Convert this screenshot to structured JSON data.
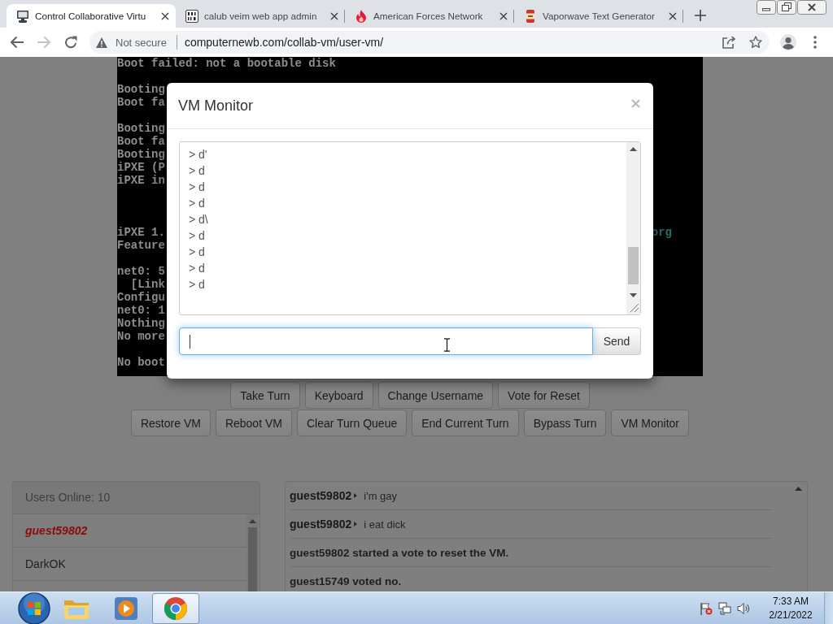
{
  "browser": {
    "tabs": [
      {
        "title": "Control Collaborative Virtu",
        "selected": true
      },
      {
        "title": "calub veim web app admin",
        "selected": false
      },
      {
        "title": "American Forces Network",
        "selected": false
      },
      {
        "title": "Vaporwave Text Generator",
        "selected": false
      }
    ],
    "nav": [
      {
        "kind": "back",
        "disabled": false
      },
      {
        "kind": "forward",
        "disabled": true
      },
      {
        "kind": "reload",
        "disabled": false
      }
    ],
    "address_bar": {
      "security": "Not secure",
      "url": "computernewb.com/collab-vm/user-vm/"
    }
  },
  "vm_screen": {
    "lines": [
      {
        "kind": "text",
        "text": "Boot failed: not a bootable disk"
      },
      {
        "kind": "blank"
      },
      {
        "kind": "text",
        "text": "Booting"
      },
      {
        "kind": "text",
        "text": "Boot fa"
      },
      {
        "kind": "blank"
      },
      {
        "kind": "text",
        "text": "Booting"
      },
      {
        "kind": "text",
        "text": "Boot fa"
      },
      {
        "kind": "text",
        "text": "Booting"
      },
      {
        "kind": "text",
        "text": "iPXE (P"
      },
      {
        "kind": "text",
        "text": "iPXE in"
      },
      {
        "kind": "blank"
      },
      {
        "kind": "blank"
      },
      {
        "kind": "blank"
      },
      {
        "kind": "split",
        "left": "iPXE 1.",
        "right": "org"
      },
      {
        "kind": "text",
        "text": "Feature"
      },
      {
        "kind": "blank"
      },
      {
        "kind": "text",
        "text": "net0: 5"
      },
      {
        "kind": "text",
        "text": "  [Link"
      },
      {
        "kind": "text",
        "text": "Configu"
      },
      {
        "kind": "text",
        "text": "net0: 1"
      },
      {
        "kind": "text",
        "text": "Nothing"
      },
      {
        "kind": "text",
        "text": "No more"
      },
      {
        "kind": "blank"
      },
      {
        "kind": "text",
        "text": "No boot"
      }
    ]
  },
  "modal": {
    "title": "VM Monitor",
    "log": [
      "> d'",
      "> d",
      "> d",
      "> d",
      "> d\\",
      "> d",
      "> d",
      "> d",
      "> d"
    ],
    "input": {
      "focused": true
    },
    "send": "Send"
  },
  "controls": {
    "row_1": [
      "Take Turn",
      "Keyboard",
      "Change Username",
      "Vote for Reset"
    ],
    "row_2": [
      "Restore VM",
      "Reboot VM",
      "Clear Turn Queue",
      "End Current Turn",
      "Bypass Turn",
      "VM Monitor"
    ]
  },
  "users": {
    "header": "Users Online: 10",
    "items": [
      {
        "name": "guest59802",
        "current_user": true
      },
      {
        "name": "DarkOK",
        "current_user": false
      }
    ]
  },
  "chat": {
    "messages": [
      {
        "kind": "user",
        "user": "guest59802",
        "text": "i'm gay"
      },
      {
        "kind": "user",
        "user": "guest59802",
        "text": "i eat dick"
      },
      {
        "kind": "system",
        "text": "guest59802 started a vote to reset the VM."
      },
      {
        "kind": "system",
        "text": "guest15749 voted no."
      }
    ]
  },
  "taskbar": {
    "apps": [
      {
        "selected": false
      },
      {
        "selected": false
      },
      {
        "selected": true
      }
    ],
    "clock": {
      "time": "7:33 AM",
      "date": "2/21/2022"
    }
  }
}
